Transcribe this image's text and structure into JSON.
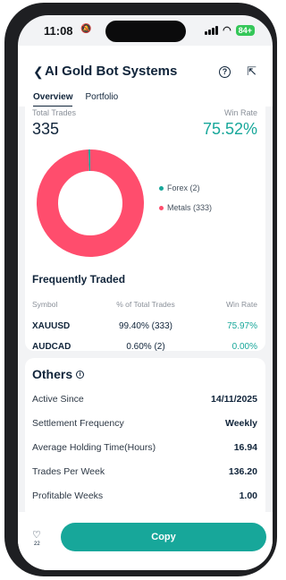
{
  "status_bar": {
    "time": "11:08",
    "battery": "84+"
  },
  "header": {
    "title": "AI Gold Bot Systems",
    "tabs": [
      {
        "label": "Overview",
        "active": true
      },
      {
        "label": "Portfolio",
        "active": false
      }
    ]
  },
  "summary": {
    "total_trades_label": "Total Trades",
    "total_trades_value": "335",
    "win_rate_label": "Win Rate",
    "win_rate_value": "75.52%"
  },
  "chart_data": {
    "type": "pie",
    "categories": [
      "Forex",
      "Metals"
    ],
    "values": [
      2,
      333
    ],
    "colors": [
      "#17a79a",
      "#ff4d6d"
    ],
    "legend": [
      "Forex (2)",
      "Metals (333)"
    ]
  },
  "frequently_traded": {
    "heading": "Frequently Traded",
    "columns": [
      "Symbol",
      "% of Total Trades",
      "Win Rate"
    ],
    "rows": [
      {
        "symbol": "XAUUSD",
        "pct": "99.40% (333)",
        "win_rate": "75.97%"
      },
      {
        "symbol": "AUDCAD",
        "pct": "0.60% (2)",
        "win_rate": "0.00%"
      }
    ]
  },
  "others": {
    "heading": "Others",
    "rows": [
      {
        "label": "Active Since",
        "value": "14/11/2025"
      },
      {
        "label": "Settlement Frequency",
        "value": "Weekly"
      },
      {
        "label": "Average Holding Time(Hours)",
        "value": "16.94"
      },
      {
        "label": "Trades Per Week",
        "value": "136.20"
      },
      {
        "label": "Profitable Weeks",
        "value": "1.00"
      }
    ]
  },
  "bottom": {
    "likes": "22",
    "copy_label": "Copy"
  },
  "colors": {
    "accent": "#17a79a",
    "metals": "#ff4d6d",
    "text": "#10243a"
  }
}
